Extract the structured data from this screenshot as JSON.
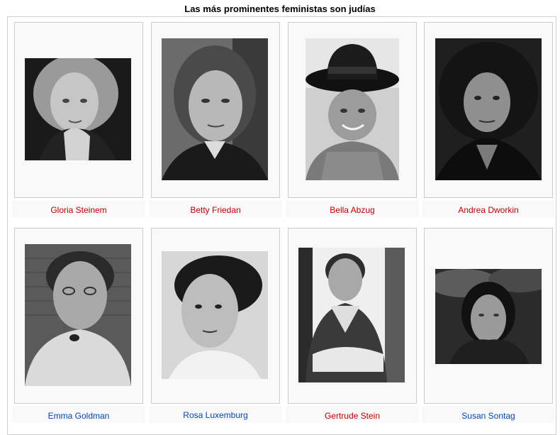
{
  "gallery": {
    "title": "Las más prominentes feministas son judías",
    "items": [
      {
        "name": "Gloria Steinem",
        "link_color": "#ba0000",
        "image": "portrait-photo"
      },
      {
        "name": "Betty Friedan",
        "link_color": "#ba0000",
        "image": "portrait-photo"
      },
      {
        "name": "Bella Abzug",
        "link_color": "#ba0000",
        "image": "portrait-photo"
      },
      {
        "name": "Andrea Dworkin",
        "link_color": "#ba0000",
        "image": "portrait-photo"
      },
      {
        "name": "Emma Goldman",
        "link_color": "#0645ad",
        "image": "portrait-photo"
      },
      {
        "name": "Rosa Luxemburg",
        "link_color": "#0645ad",
        "image": "portrait-photo"
      },
      {
        "name": "Gertrude Stein",
        "link_color": "#ba0000",
        "image": "portrait-photo"
      },
      {
        "name": "Susan Sontag",
        "link_color": "#0645ad",
        "image": "portrait-photo"
      }
    ]
  }
}
